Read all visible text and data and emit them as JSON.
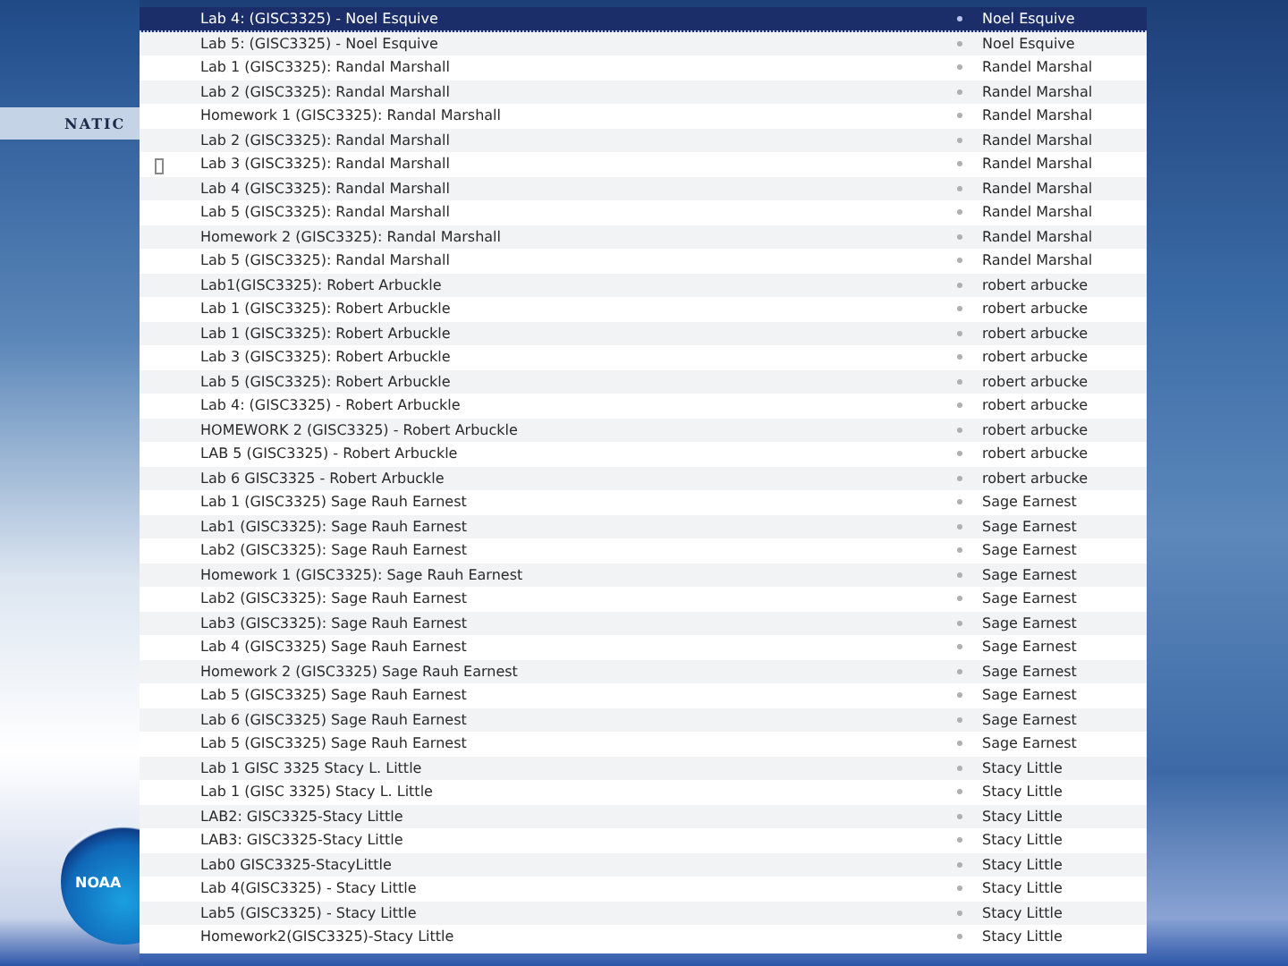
{
  "slide": {
    "heading": "NATIC",
    "logo_text": "NOAA"
  },
  "list": {
    "rows": [
      {
        "title": "Lab 4: (GISC3325) - Noel Esquive",
        "author": "Noel Esquive",
        "selected": true
      },
      {
        "title": "Lab 5: (GISC3325) - Noel Esquive",
        "author": "Noel Esquive",
        "selected": false
      },
      {
        "title": "Lab 1 (GISC3325): Randal Marshall",
        "author": "Randel Marshal",
        "selected": false
      },
      {
        "title": "Lab 2 (GISC3325): Randal Marshall",
        "author": "Randel Marshal",
        "selected": false
      },
      {
        "title": "Homework 1 (GISC3325): Randal Marshall",
        "author": "Randel Marshal",
        "selected": false
      },
      {
        "title": "Lab 2 (GISC3325): Randal Marshall",
        "author": "Randel Marshal",
        "selected": false
      },
      {
        "title": "Lab 3 (GISC3325): Randal Marshall",
        "author": "Randel Marshal",
        "selected": false
      },
      {
        "title": "Lab 4 (GISC3325): Randal Marshall",
        "author": "Randel Marshal",
        "selected": false
      },
      {
        "title": "Lab 5 (GISC3325): Randal Marshall",
        "author": "Randel Marshal",
        "selected": false
      },
      {
        "title": "Homework 2 (GISC3325): Randal Marshall",
        "author": "Randel Marshal",
        "selected": false
      },
      {
        "title": "Lab 5 (GISC3325): Randal Marshall",
        "author": "Randel Marshal",
        "selected": false
      },
      {
        "title": "Lab1(GISC3325): Robert Arbuckle",
        "author": "robert arbucke",
        "selected": false
      },
      {
        "title": "Lab 1 (GISC3325): Robert Arbuckle",
        "author": "robert arbucke",
        "selected": false
      },
      {
        "title": "Lab 1 (GISC3325): Robert Arbuckle",
        "author": "robert arbucke",
        "selected": false
      },
      {
        "title": "Lab 3 (GISC3325): Robert Arbuckle",
        "author": "robert arbucke",
        "selected": false
      },
      {
        "title": "Lab 5 (GISC3325): Robert Arbuckle",
        "author": "robert arbucke",
        "selected": false
      },
      {
        "title": "Lab 4: (GISC3325) - Robert Arbuckle",
        "author": "robert arbucke",
        "selected": false
      },
      {
        "title": "HOMEWORK 2 (GISC3325) - Robert Arbuckle",
        "author": "robert arbucke",
        "selected": false
      },
      {
        "title": "LAB 5 (GISC3325) - Robert Arbuckle",
        "author": "robert arbucke",
        "selected": false
      },
      {
        "title": "Lab 6 GISC3325 - Robert Arbuckle",
        "author": "robert arbucke",
        "selected": false
      },
      {
        "title": "Lab 1 (GISC3325) Sage Rauh Earnest",
        "author": "Sage Earnest",
        "selected": false
      },
      {
        "title": "Lab1 (GISC3325): Sage Rauh Earnest",
        "author": "Sage Earnest",
        "selected": false
      },
      {
        "title": "Lab2 (GISC3325): Sage Rauh Earnest",
        "author": "Sage Earnest",
        "selected": false
      },
      {
        "title": "Homework 1 (GISC3325): Sage Rauh Earnest",
        "author": "Sage Earnest",
        "selected": false
      },
      {
        "title": "Lab2 (GISC3325): Sage Rauh Earnest",
        "author": "Sage Earnest",
        "selected": false
      },
      {
        "title": "Lab3 (GISC3325): Sage Rauh Earnest",
        "author": "Sage Earnest",
        "selected": false
      },
      {
        "title": "Lab 4 (GISC3325) Sage Rauh Earnest",
        "author": "Sage Earnest",
        "selected": false
      },
      {
        "title": "Homework 2 (GISC3325) Sage Rauh Earnest",
        "author": "Sage Earnest",
        "selected": false
      },
      {
        "title": "Lab 5 (GISC3325) Sage Rauh Earnest",
        "author": "Sage Earnest",
        "selected": false
      },
      {
        "title": "Lab 6 (GISC3325) Sage Rauh Earnest",
        "author": "Sage Earnest",
        "selected": false
      },
      {
        "title": "Lab 5 (GISC3325) Sage Rauh Earnest",
        "author": "Sage Earnest",
        "selected": false
      },
      {
        "title": "Lab 1 GISC 3325 Stacy L. Little",
        "author": "Stacy Little",
        "selected": false
      },
      {
        "title": "Lab 1 (GISC 3325) Stacy L. Little",
        "author": "Stacy Little",
        "selected": false
      },
      {
        "title": "LAB2: GISC3325-Stacy Little",
        "author": "Stacy Little",
        "selected": false
      },
      {
        "title": "LAB3: GISC3325-Stacy Little",
        "author": "Stacy Little",
        "selected": false
      },
      {
        "title": "Lab0 GISC3325-StacyLittle",
        "author": "Stacy Little",
        "selected": false
      },
      {
        "title": "Lab 4(GISC3325) - Stacy Little",
        "author": "Stacy Little",
        "selected": false
      },
      {
        "title": "Lab5 (GISC3325) - Stacy Little",
        "author": "Stacy Little",
        "selected": false
      },
      {
        "title": "Homework2(GISC3325)-Stacy Little",
        "author": "Stacy Little",
        "selected": false
      }
    ]
  }
}
